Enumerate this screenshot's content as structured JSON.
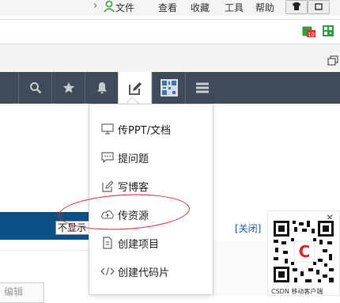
{
  "browser": {
    "menu": [
      "文件",
      "查看",
      "收藏",
      "工具",
      "帮助"
    ],
    "icons": [
      "chevron-right-icon",
      "user-icon",
      "shirt-icon",
      "window-restore-icon",
      "calendar-extension-icon",
      "qr-extension-icon",
      "restore-icon"
    ],
    "calendar_badge": "10"
  },
  "toolbar": {
    "buttons": [
      "search-icon",
      "star-icon",
      "bell-icon",
      "edit-icon",
      "qr-icon",
      "menu-icon"
    ],
    "active": "edit-icon",
    "bg_color": "#3f4b59"
  },
  "dropdown": {
    "items": [
      {
        "icon": "monitor-icon",
        "label": "传PPT/文档"
      },
      {
        "icon": "chat-bubble-icon",
        "label": "提问题"
      },
      {
        "icon": "pencil-square-icon",
        "label": "写博客"
      },
      {
        "icon": "cloud-upload-icon",
        "label": "传资源"
      },
      {
        "icon": "document-icon",
        "label": "创建项目"
      },
      {
        "icon": "code-icon",
        "label": "创建代码片"
      }
    ],
    "highlighted": "传资源",
    "highlight_color": "#d9272e"
  },
  "page": {
    "select_value": "不显示",
    "close_link": "[关闭]",
    "edit_button": "编辑"
  },
  "qr_popup": {
    "close": "✕",
    "caption": "CSDN 移动客户端",
    "logo_letter": "C",
    "logo_color": "#d9272e"
  }
}
